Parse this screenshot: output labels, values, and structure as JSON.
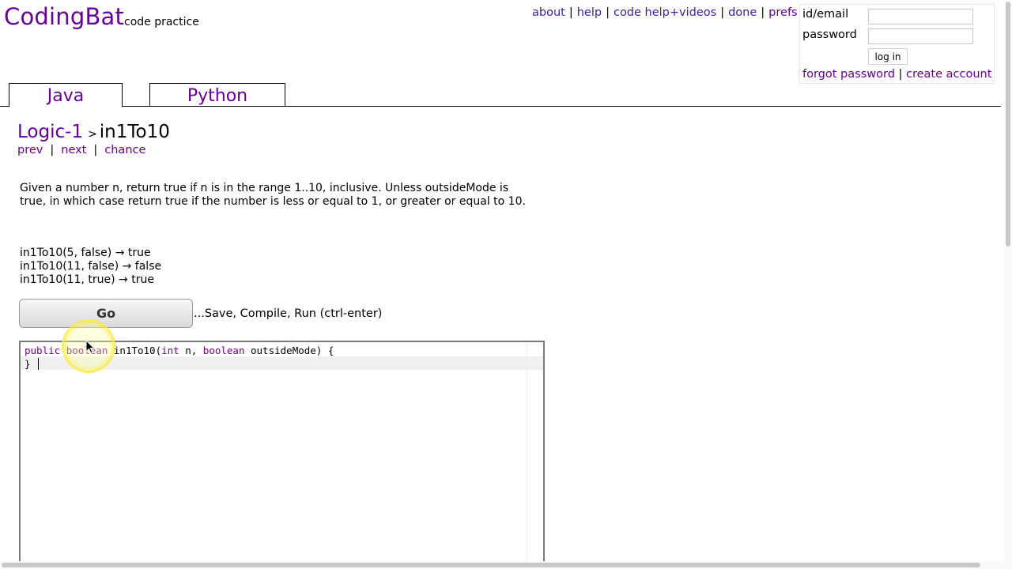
{
  "header": {
    "logo": "CodingBat",
    "tagline": "code practice",
    "links": [
      "about",
      "help",
      "code help+videos",
      "done",
      "prefs"
    ],
    "separator": "|"
  },
  "login": {
    "id_label": "id/email",
    "id_value": "",
    "password_label": "password",
    "password_value": "",
    "login_button": "log in",
    "forgot_link": "forgot password",
    "link_separator": "|",
    "create_link": "create account"
  },
  "tabs": {
    "java": "Java",
    "python": "Python",
    "active": "Java"
  },
  "breadcrumb": {
    "category": "Logic-1",
    "arrow": ">",
    "problem": "in1To10"
  },
  "nav": {
    "prev": "prev",
    "next": "next",
    "chance": "chance",
    "separator": "|"
  },
  "problem": {
    "description": "Given a number n, return true if n is in the range 1..10, inclusive. Unless outsideMode is true, in which case return true if the number is less or equal to 1, or greater or equal to 10.",
    "examples": [
      "in1To10(5, false) → true",
      "in1To10(11, false) → false",
      "in1To10(11, true) → true"
    ]
  },
  "run": {
    "go_label": "Go",
    "note": "...Save, Compile, Run (ctrl-enter)"
  },
  "editor": {
    "kw_public": "public",
    "kw_boolean": "boolean",
    "method_name": " in1To10(",
    "kw_int": "int",
    "param_n": " n, ",
    "kw_boolean2": "boolean",
    "param_rest": " outsideMode) {",
    "line2": "",
    "line3": "}"
  },
  "colors": {
    "brand_purple": "#660099",
    "link_blue": "#3c1f9e",
    "keyword": "#770088"
  }
}
